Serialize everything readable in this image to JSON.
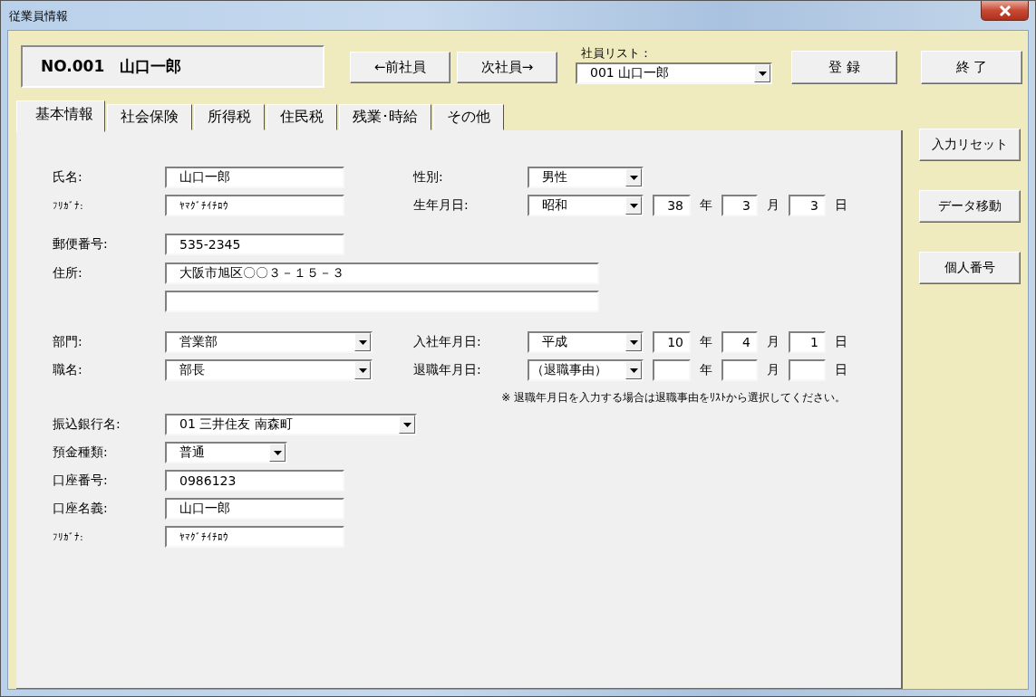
{
  "window": {
    "title": "従業員情報"
  },
  "header": {
    "employee": "NO.001　山口一郎"
  },
  "nav_buttons": [
    "←前社員",
    "次社員→"
  ],
  "employee_list": {
    "label": "社員リスト：",
    "value": "001 山口一郎"
  },
  "action_buttons": [
    "登 録",
    "終 了"
  ],
  "tabs": [
    {
      "label": "基本情報",
      "selected": true
    },
    {
      "label": "社会保険",
      "selected": false
    },
    {
      "label": "所得税",
      "selected": false
    },
    {
      "label": "住民税",
      "selected": false
    },
    {
      "label": "残業･時給",
      "selected": false
    },
    {
      "label": "その他",
      "selected": false
    }
  ],
  "side_buttons": [
    "入力リセット",
    "データ移動",
    "個人番号"
  ],
  "form": {
    "name": {
      "label": "氏名:",
      "value": "山口一郎"
    },
    "furigana": {
      "label": "ﾌﾘｶﾞﾅ:",
      "value": "ﾔﾏｸﾞﾁｲﾁﾛｳ"
    },
    "gender": {
      "label": "性別:",
      "value": "男性"
    },
    "birth_date": {
      "label": "生年月日:",
      "era": "昭和",
      "year": "38",
      "year_unit": "年",
      "month": "3",
      "month_unit": "月",
      "day": "3",
      "day_unit": "日"
    },
    "postal_code": {
      "label": "郵便番号:",
      "value": "535-2345"
    },
    "address": {
      "label": "住所:",
      "line1": "大阪市旭区〇〇３－１５－３"
    },
    "department": {
      "label": "部門:",
      "value": "営業部"
    },
    "position": {
      "label": "職名:",
      "value": "部長"
    },
    "hire_date": {
      "label": "入社年月日:",
      "era": "平成",
      "year": "10",
      "year_unit": "年",
      "month": "4",
      "month_unit": "月",
      "day": "1",
      "day_unit": "日"
    },
    "retire_date": {
      "label": "退職年月日:",
      "era": "（退職事由）",
      "year_unit": "年",
      "month_unit": "月",
      "day_unit": "日"
    },
    "note": "※ 退職年月日を入力する場合は退職事由をﾘｽﾄから選択してください。",
    "bank": {
      "label": "振込銀行名:",
      "value": "01 三井住友  南森町"
    },
    "account_type": {
      "label": "預金種類:",
      "value": "普通"
    },
    "account_number": {
      "label": "口座番号:",
      "value": "0986123"
    },
    "account_name": {
      "label": "口座名義:",
      "value": "山口一郎"
    },
    "account_furigana": {
      "label": "ﾌﾘｶﾞﾅ:",
      "value": "ﾔﾏｸﾞﾁｲﾁﾛｳ"
    }
  }
}
